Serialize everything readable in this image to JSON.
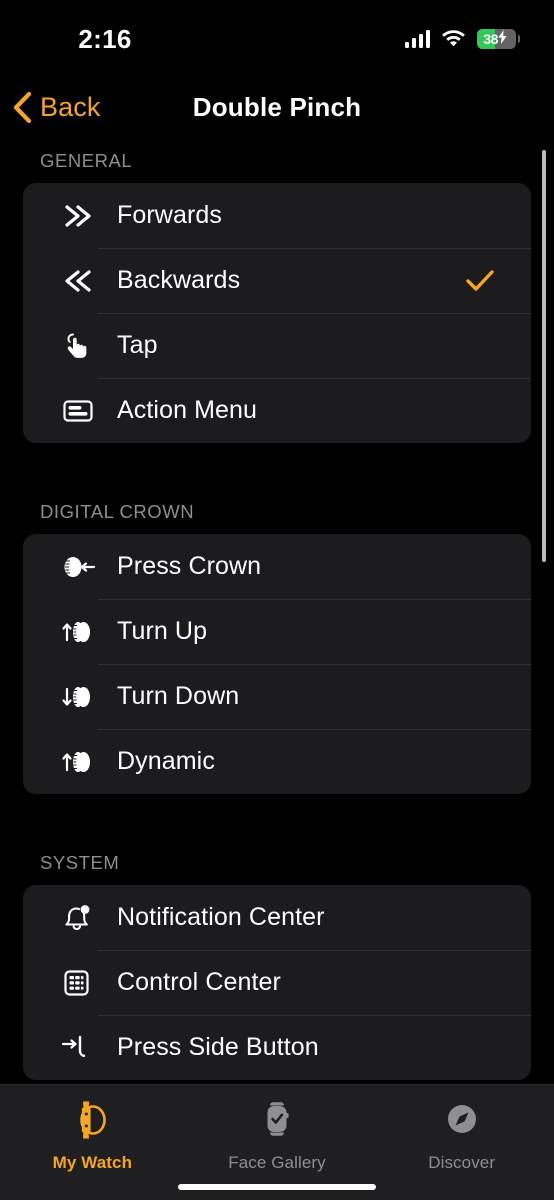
{
  "status_bar": {
    "time": "2:16",
    "cellular_icon": "cellular-bars-icon",
    "wifi_icon": "wifi-icon",
    "battery_percent": "38",
    "battery_charging": true,
    "battery_fill_color": "#34C759"
  },
  "nav": {
    "back_label": "Back",
    "back_icon": "chevron-left-icon",
    "title": "Double Pinch",
    "accent_color": "#F5A623"
  },
  "sections": [
    {
      "header": "GENERAL",
      "rows": [
        {
          "icon": "chevron-double-right-icon",
          "label": "Forwards",
          "checked": false
        },
        {
          "icon": "chevron-double-left-icon",
          "label": "Backwards",
          "checked": true
        },
        {
          "icon": "tap-hand-icon",
          "label": "Tap",
          "checked": false
        },
        {
          "icon": "action-menu-icon",
          "label": "Action Menu",
          "checked": false
        }
      ]
    },
    {
      "header": "DIGITAL CROWN",
      "rows": [
        {
          "icon": "crown-press-icon",
          "label": "Press Crown",
          "checked": false
        },
        {
          "icon": "crown-turn-up-icon",
          "label": "Turn Up",
          "checked": false
        },
        {
          "icon": "crown-turn-down-icon",
          "label": "Turn Down",
          "checked": false
        },
        {
          "icon": "crown-dynamic-icon",
          "label": "Dynamic",
          "checked": false
        }
      ]
    },
    {
      "header": "SYSTEM",
      "rows": [
        {
          "icon": "bell-icon",
          "label": "Notification Center",
          "checked": false
        },
        {
          "icon": "control-center-icon",
          "label": "Control Center",
          "checked": false
        },
        {
          "icon": "side-button-icon",
          "label": "Press Side Button",
          "checked": false
        }
      ]
    }
  ],
  "tab_bar": {
    "tabs": [
      {
        "label": "My Watch",
        "icon": "watch-icon",
        "active": true
      },
      {
        "label": "Face Gallery",
        "icon": "watch-face-icon",
        "active": false
      },
      {
        "label": "Discover",
        "icon": "compass-icon",
        "active": false
      }
    ],
    "active_color": "#F5A623",
    "inactive_color": "#8e8e93"
  }
}
